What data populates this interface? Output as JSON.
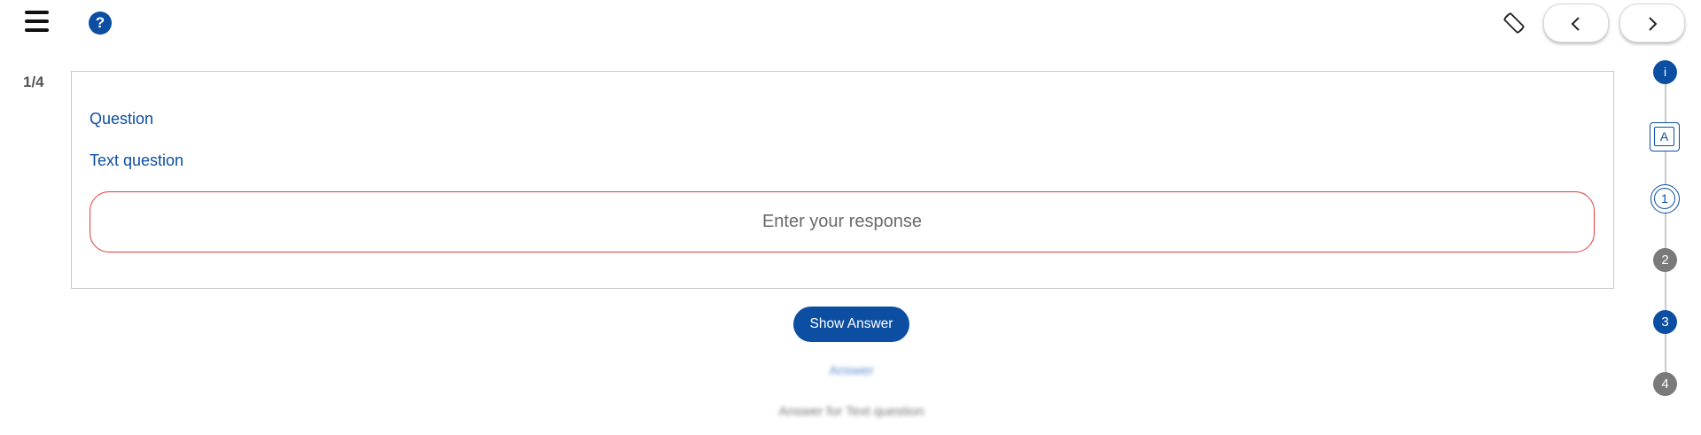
{
  "header": {
    "menu_icon": "hamburger-menu-icon",
    "help_icon": "question-mark-icon",
    "help_glyph": "?",
    "rotate_icon": "screen-rotation-icon",
    "prev_icon": "chevron-left-icon",
    "next_icon": "chevron-right-icon"
  },
  "progress": {
    "counter": "1/4"
  },
  "question": {
    "label": "Question",
    "text": "Text question",
    "response_placeholder": "Enter your response",
    "response_value": ""
  },
  "actions": {
    "show_answer": "Show Answer"
  },
  "answer": {
    "label": "Answer",
    "text": "Answer for Text question"
  },
  "stepper": {
    "info": "i",
    "attempt": "A",
    "steps": [
      "1",
      "2",
      "3",
      "4"
    ]
  },
  "colors": {
    "primary": "#0b4ea2",
    "error_border": "#e03a3a",
    "inactive_step": "#7a7a7a"
  }
}
